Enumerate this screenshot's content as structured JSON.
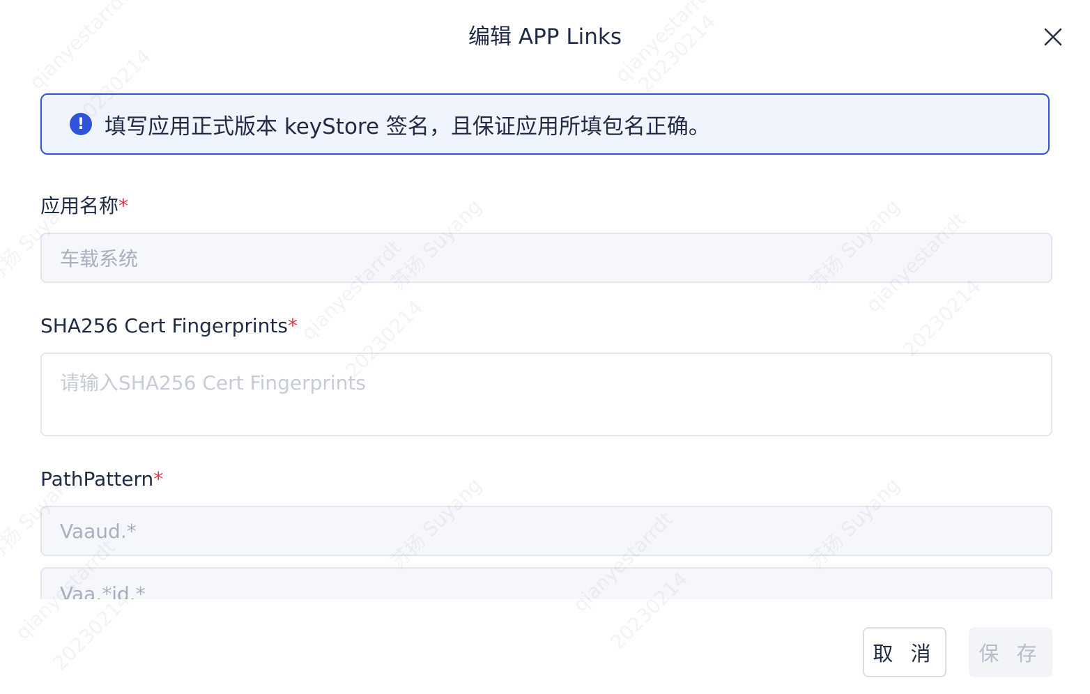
{
  "dialog": {
    "title": "编辑 APP Links",
    "close_icon": "close-icon"
  },
  "alert": {
    "icon": "exclamation-circle-icon",
    "text": "填写应用正式版本 keyStore 签名，且保证应用所填包名正确。",
    "accent_color": "#2d54d9"
  },
  "form": {
    "app_name": {
      "label": "应用名称",
      "required_mark": "*",
      "value": "车载系统"
    },
    "sha256": {
      "label": "SHA256 Cert Fingerprints",
      "required_mark": "*",
      "placeholder": "请输入SHA256 Cert Fingerprints"
    },
    "path_pattern": {
      "label": "PathPattern",
      "required_mark": "*",
      "values": [
        "Vaaud.*",
        "Vaa.*id.*"
      ]
    }
  },
  "footer": {
    "cancel_label": "取 消",
    "save_label": "保 存"
  },
  "watermarks": [
    "qianyestarrdt",
    "20230214",
    "苏扬 Suyang"
  ],
  "colors": {
    "primary": "#2d54d9",
    "required": "#e5344a",
    "text": "#1f2a44"
  }
}
